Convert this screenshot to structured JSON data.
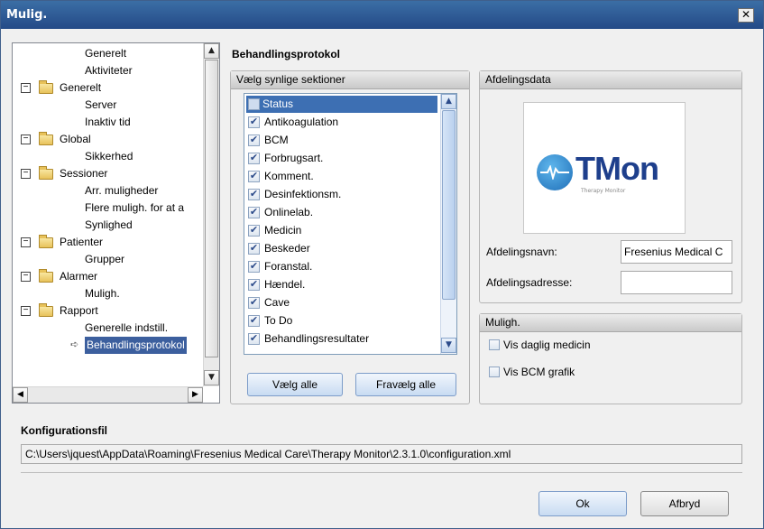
{
  "window": {
    "title": "Mulig."
  },
  "tree": {
    "items": [
      {
        "label": "Generelt",
        "level": 2
      },
      {
        "label": "Aktiviteter",
        "level": 2
      },
      {
        "label": "Generelt",
        "level": 1
      },
      {
        "label": "Server",
        "level": 2
      },
      {
        "label": "Inaktiv tid",
        "level": 2
      },
      {
        "label": "Global",
        "level": 1
      },
      {
        "label": "Sikkerhed",
        "level": 2
      },
      {
        "label": "Sessioner",
        "level": 1
      },
      {
        "label": "Arr. muligheder",
        "level": 2
      },
      {
        "label": "Flere muligh. for at a",
        "level": 2
      },
      {
        "label": "Synlighed",
        "level": 2
      },
      {
        "label": "Patienter",
        "level": 1
      },
      {
        "label": "Grupper",
        "level": 2
      },
      {
        "label": "Alarmer",
        "level": 1
      },
      {
        "label": "Muligh.",
        "level": 2
      },
      {
        "label": "Rapport",
        "level": 1
      },
      {
        "label": "Generelle indstill.",
        "level": 2
      },
      {
        "label": "Behandlingsprotokol",
        "level": 2,
        "selected": true
      }
    ]
  },
  "page_title": "Behandlingsprotokol",
  "sections": {
    "header": "Vælg synlige sektioner",
    "items": [
      {
        "label": "Status",
        "checked": false,
        "selected": true
      },
      {
        "label": "Antikoagulation",
        "checked": true
      },
      {
        "label": "BCM",
        "checked": true
      },
      {
        "label": "Forbrugsart.",
        "checked": true
      },
      {
        "label": "Komment.",
        "checked": true
      },
      {
        "label": "Desinfektionsm.",
        "checked": true
      },
      {
        "label": "Onlinelab.",
        "checked": true
      },
      {
        "label": "Medicin",
        "checked": true
      },
      {
        "label": "Beskeder",
        "checked": true
      },
      {
        "label": "Foranstal.",
        "checked": true
      },
      {
        "label": "Hændel.",
        "checked": true
      },
      {
        "label": "Cave",
        "checked": true
      },
      {
        "label": "To Do",
        "checked": true
      },
      {
        "label": "Behandlingsresultater",
        "checked": true
      }
    ],
    "select_all_label": "Vælg alle",
    "deselect_all_label": "Fravælg alle"
  },
  "department": {
    "header": "Afdelingsdata",
    "logo_text": "TMon",
    "logo_subtitle": "Therapy Monitor",
    "name_label": "Afdelingsnavn:",
    "name_value": "Fresenius Medical C",
    "address_label": "Afdelingsadresse:",
    "address_value": ""
  },
  "options": {
    "header": "Muligh.",
    "daily_medicine_label": "Vis daglig medicin",
    "bcm_graph_label": "Vis BCM grafik"
  },
  "config": {
    "heading": "Konfigurationsfil",
    "path": "C:\\Users\\jquest\\AppData\\Roaming\\Fresenius Medical Care\\Therapy Monitor\\2.3.1.0\\configuration.xml"
  },
  "footer": {
    "ok_label": "Ok",
    "cancel_label": "Afbryd"
  },
  "colors": {
    "titlebar": "#2f5e9c",
    "selection": "#3d6fb3",
    "logo_blue": "#1e3f8c"
  }
}
